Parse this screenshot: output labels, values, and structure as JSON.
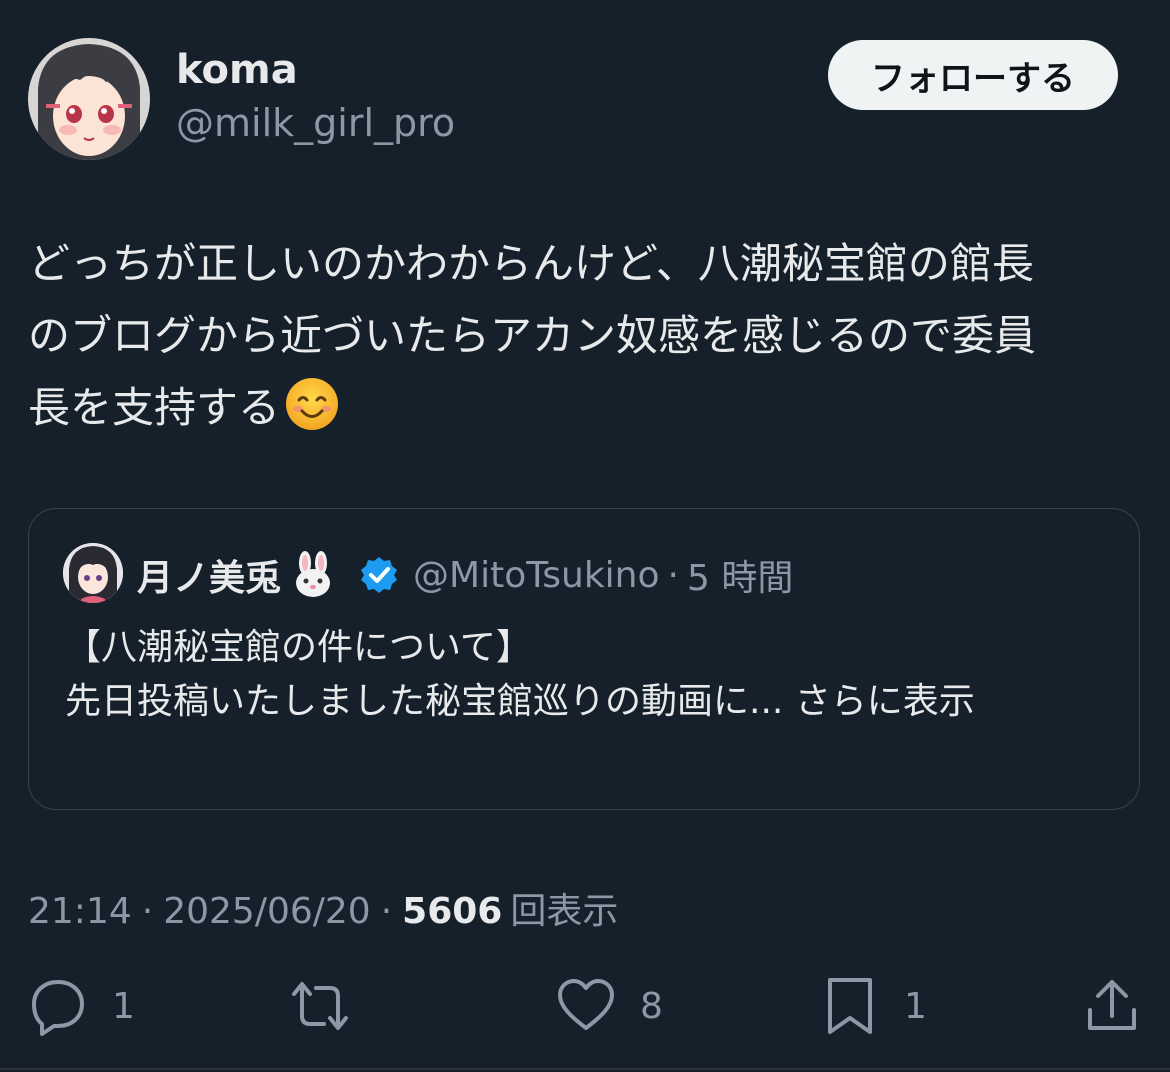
{
  "author": {
    "display_name": "koma",
    "handle": "@milk_girl_pro",
    "avatar_icon": "anime-girl-avatar"
  },
  "follow_button": {
    "label": "フォローする"
  },
  "tweet": {
    "lines": [
      "どっちが正しいのかわからんけど、八潮秘宝館の館長",
      "のブログから近づいたらアカン奴感を感じるので委員",
      "長を支持する"
    ],
    "emoji": "smiling-face-with-smiling-eyes"
  },
  "quoted_tweet": {
    "display_name": "月ノ美兎",
    "name_emoji": "rabbit-face",
    "verified_icon": "verified-badge-icon",
    "handle": "@MitoTsukino",
    "separator": "·",
    "time": "5 時間",
    "text_line1": "【八潮秘宝館の件について】",
    "text_line2": "先日投稿いたしました秘宝館巡りの動画に...",
    "show_more": "さらに表示"
  },
  "meta": {
    "time": "21:14",
    "sep1": "·",
    "date": "2025/06/20",
    "sep2": "·",
    "views_count": "5606",
    "views_label": "回表示"
  },
  "actions": {
    "reply_count": "1",
    "repost_count": "",
    "like_count": "8",
    "bookmark_count": "1"
  },
  "colors": {
    "background": "#15202b",
    "text": "#e7e9ea",
    "secondary": "#8b98a5",
    "border": "#38444d",
    "follow_bg": "#eff3f4",
    "verified": "#1d9bf0"
  }
}
